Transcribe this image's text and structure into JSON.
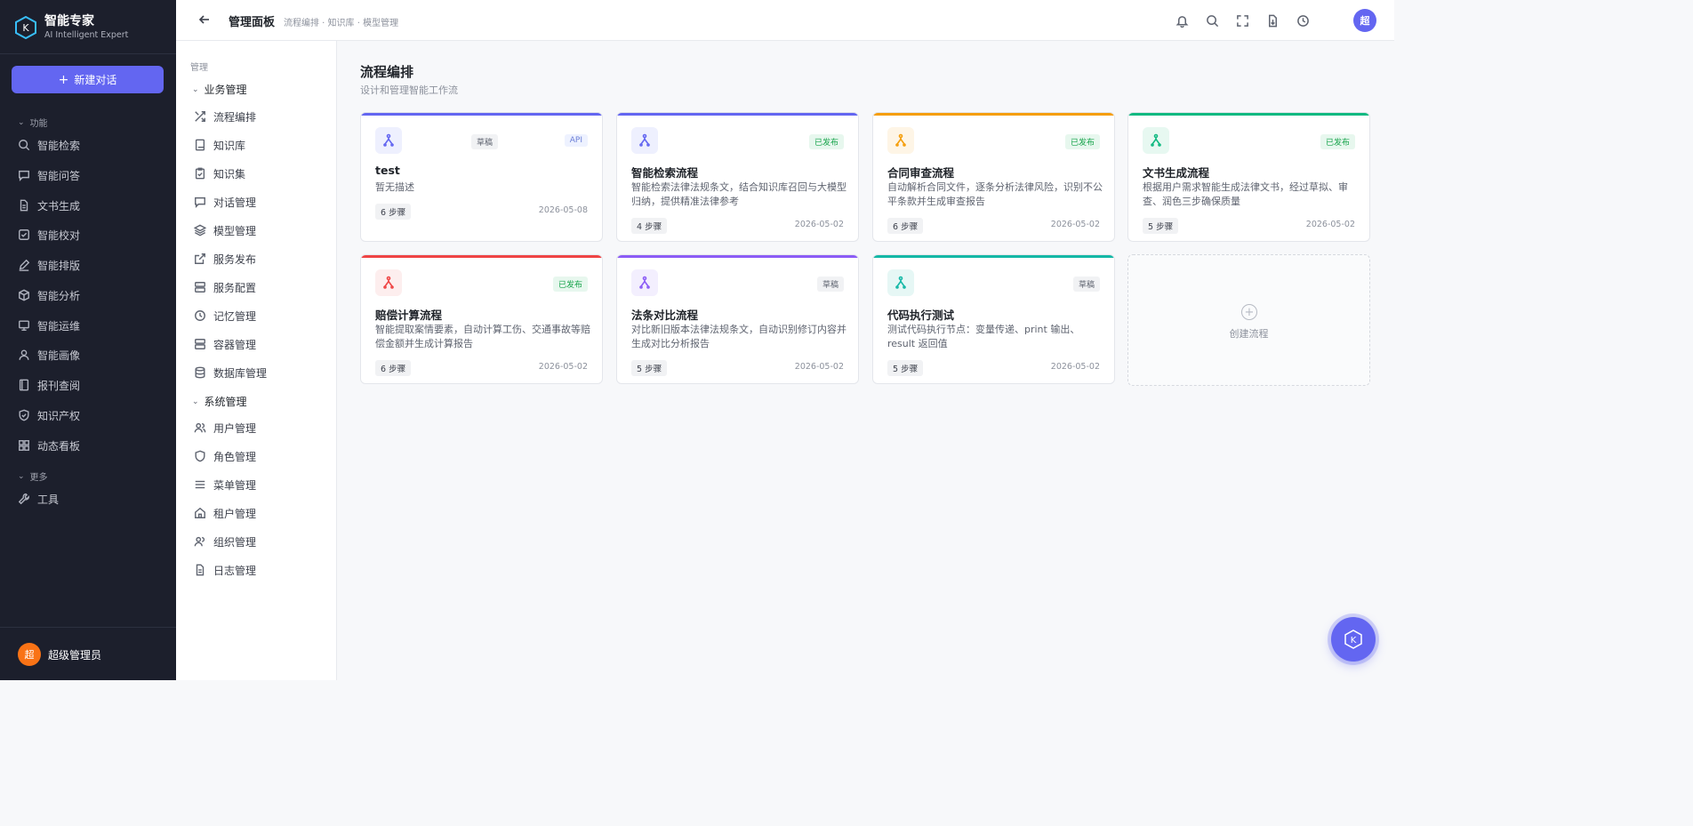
{
  "brand": {
    "title": "智能专家",
    "subtitle": "AI Intelligent Expert"
  },
  "new_chat_label": "新建对话",
  "sidebar": {
    "group_features": "功能",
    "items": [
      "智能检索",
      "智能问答",
      "文书生成",
      "智能校对",
      "智能排版",
      "智能分析",
      "智能运维",
      "智能画像",
      "报刊查阅",
      "知识产权",
      "动态看板"
    ],
    "group_more": "更多",
    "more_items": [
      "工具"
    ]
  },
  "user": {
    "avatar": "超",
    "name": "超级管理员"
  },
  "header": {
    "title": "管理面板",
    "breadcrumb": "流程编排 · 知识库 · 模型管理",
    "avatar": "超"
  },
  "panel": {
    "label": "管理",
    "group_business": "业务管理",
    "business_items": [
      "流程编排",
      "知识库",
      "知识集",
      "对话管理",
      "模型管理",
      "服务发布",
      "服务配置",
      "记忆管理",
      "容器管理",
      "数据库管理"
    ],
    "group_system": "系统管理",
    "system_items": [
      "用户管理",
      "角色管理",
      "菜单管理",
      "租户管理",
      "组织管理",
      "日志管理"
    ]
  },
  "main": {
    "title": "流程编排",
    "subtitle": "设计和管理智能工作流",
    "create_label": "创建流程"
  },
  "cards": [
    {
      "title": "test",
      "desc": "暂无描述",
      "status": "草稿",
      "api": "API",
      "steps": "6 步骤",
      "date": "2026-05-08",
      "accent": "#6366f1"
    },
    {
      "title": "智能检索流程",
      "desc": "智能检索法律法规条文，结合知识库召回与大模型归纳，提供精准法律参考",
      "status": "已发布",
      "steps": "4 步骤",
      "date": "2026-05-02",
      "accent": "#6366f1"
    },
    {
      "title": "合同审查流程",
      "desc": "自动解析合同文件，逐条分析法律风险，识别不公平条款并生成审查报告",
      "status": "已发布",
      "steps": "6 步骤",
      "date": "2026-05-02",
      "accent": "#f59e0b"
    },
    {
      "title": "文书生成流程",
      "desc": "根据用户需求智能生成法律文书，经过草拟、审查、润色三步确保质量",
      "status": "已发布",
      "steps": "5 步骤",
      "date": "2026-05-02",
      "accent": "#10b981"
    },
    {
      "title": "赔偿计算流程",
      "desc": "智能提取案情要素，自动计算工伤、交通事故等赔偿金额并生成计算报告",
      "status": "已发布",
      "steps": "6 步骤",
      "date": "2026-05-02",
      "accent": "#ef4444"
    },
    {
      "title": "法条对比流程",
      "desc": "对比新旧版本法律法规条文，自动识别修订内容并生成对比分析报告",
      "status": "草稿",
      "steps": "5 步骤",
      "date": "2026-05-02",
      "accent": "#8b5cf6"
    },
    {
      "title": "代码执行测试",
      "desc": "测试代码执行节点：变量传递、print 输出、result 返回值",
      "status": "草稿",
      "steps": "5 步骤",
      "date": "2026-05-02",
      "accent": "#14b8a6"
    }
  ]
}
